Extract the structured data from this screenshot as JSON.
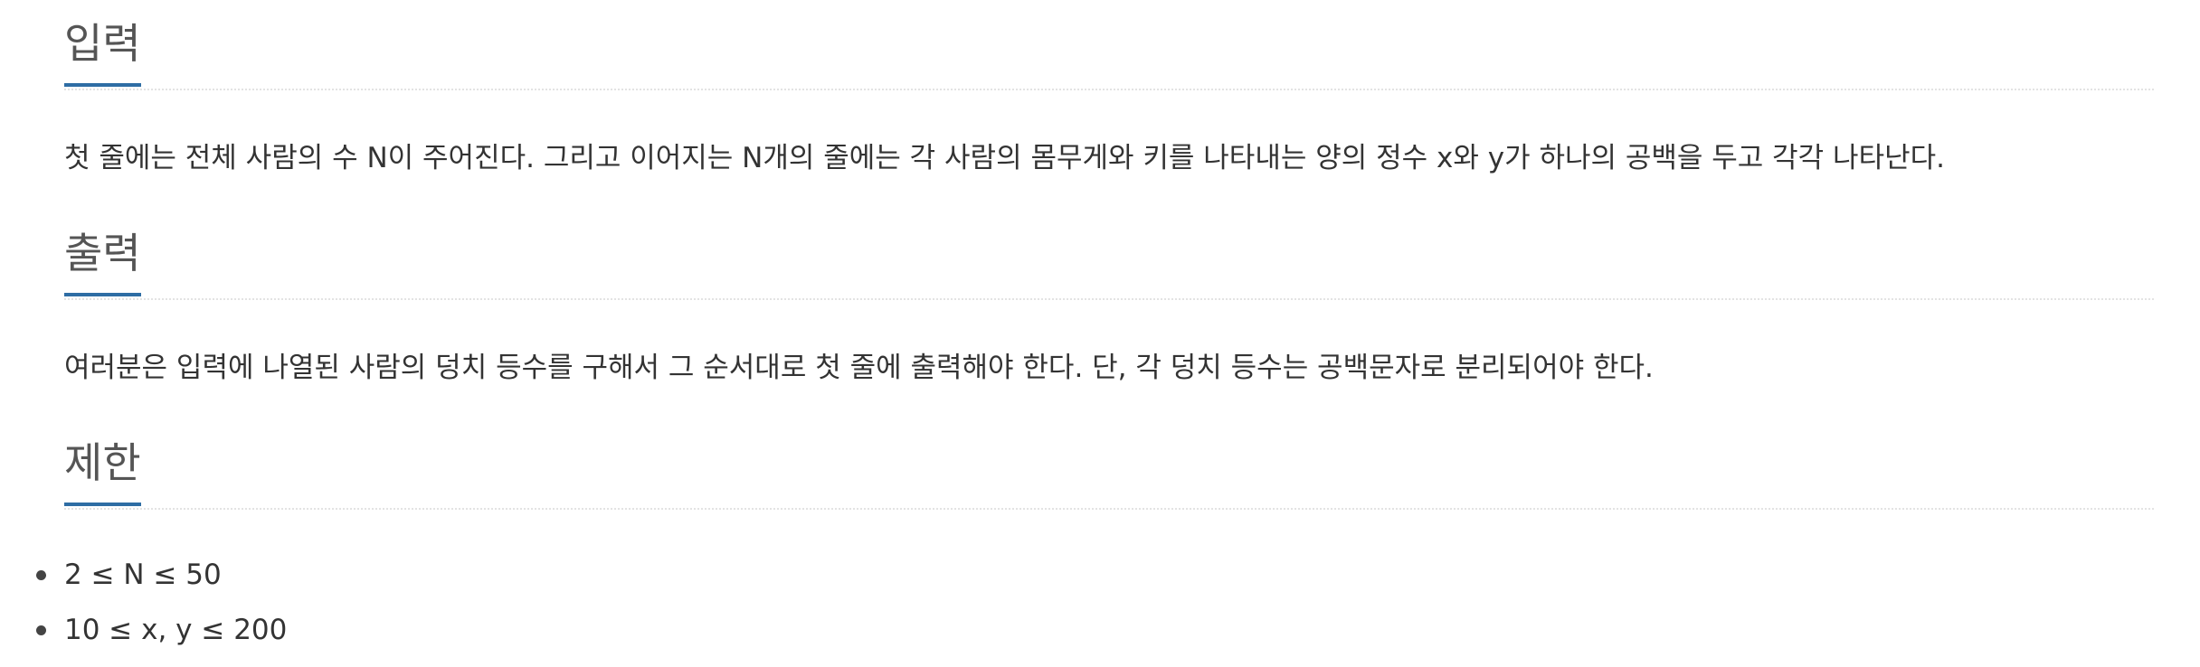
{
  "sections": {
    "input": {
      "title": "입력",
      "text": "첫 줄에는 전체 사람의 수 N이 주어진다. 그리고 이어지는 N개의 줄에는 각 사람의 몸무게와 키를 나타내는 양의 정수 x와 y가 하나의 공백을 두고 각각 나타난다."
    },
    "output": {
      "title": "출력",
      "text": "여러분은 입력에 나열된 사람의 덩치 등수를 구해서 그 순서대로 첫 줄에 출력해야 한다. 단, 각 덩치 등수는 공백문자로 분리되어야 한다."
    },
    "limit": {
      "title": "제한",
      "items": [
        "2 ≤ N ≤ 50",
        "10 ≤ x, y ≤ 200"
      ]
    }
  },
  "colors": {
    "accent_underline": "#2e6da4",
    "title_text": "#555555",
    "body_text": "#333333",
    "divider": "#e3e3e3"
  },
  "icons": {
    "bullet": "bullet-dot-icon"
  }
}
